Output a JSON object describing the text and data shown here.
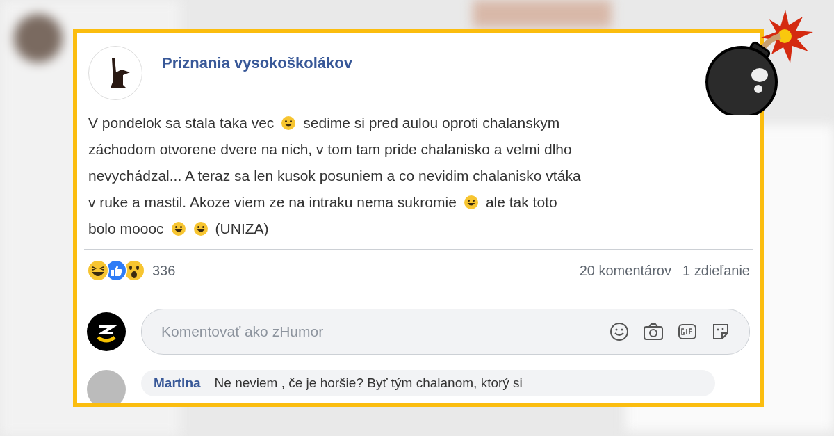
{
  "post": {
    "page_name": "Priznania vysokoškolákov",
    "lines": [
      [
        {
          "kind": "text",
          "text": "V pondelok sa stala taka vec"
        },
        {
          "kind": "emoji"
        },
        {
          "kind": "text",
          "text": "sedime si pred aulou oproti chalanskym"
        }
      ],
      [
        {
          "kind": "text",
          "text": "záchodom otvorene dvere na nich, v tom tam pride chalanisko a velmi dlho"
        }
      ],
      [
        {
          "kind": "text",
          "text": "nevychádzal... A teraz sa len kusok posuniem a co nevidim chalanisko vtáka"
        }
      ],
      [
        {
          "kind": "text",
          "text": "v ruke a mastil. Akoze viem ze na intraku nema sukromie"
        },
        {
          "kind": "emoji"
        },
        {
          "kind": "text",
          "text": "ale tak toto"
        }
      ],
      [
        {
          "kind": "text",
          "text": "bolo moooc"
        },
        {
          "kind": "emoji"
        },
        {
          "kind": "emoji"
        },
        {
          "kind": "text",
          "text": "(UNIZA)"
        }
      ]
    ],
    "reactions": [
      {
        "kind": "haha"
      },
      {
        "kind": "like"
      },
      {
        "kind": "wow"
      }
    ],
    "reaction_count": "336",
    "comments_count": "20 komentárov",
    "shares_count": "1 zdieľanie"
  },
  "comment_box": {
    "placeholder": "Komentovať ako zHumor"
  },
  "comment": {
    "author": "Martina",
    "text": "Ne neviem , če je horšie? Byť tým chalanom, ktorý si"
  }
}
